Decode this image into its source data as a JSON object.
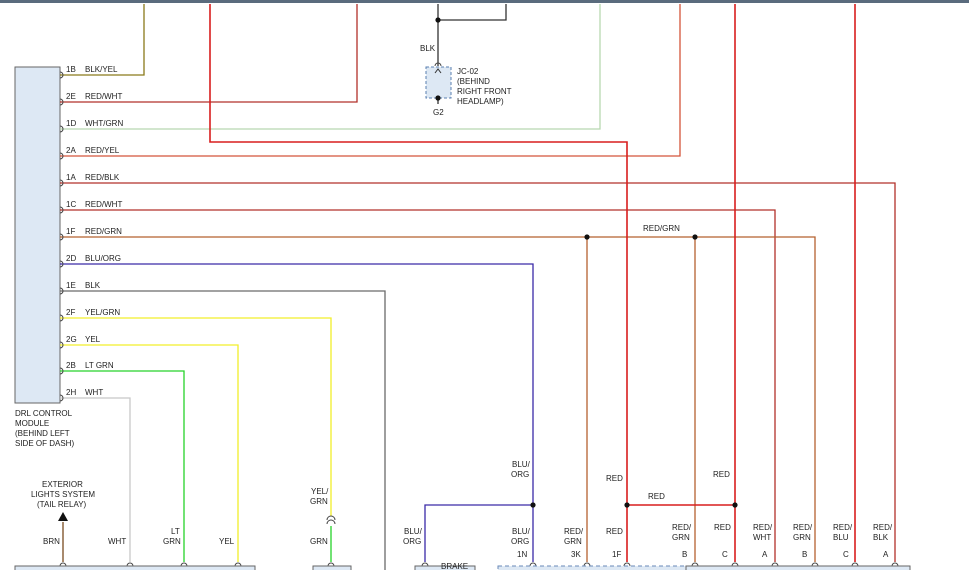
{
  "module": {
    "label_lines": [
      "DRL CONTROL",
      "MODULE",
      "(BEHIND LEFT",
      "SIDE OF DASH)"
    ],
    "pins": [
      {
        "pin": "1B",
        "wire": "BLK/YEL"
      },
      {
        "pin": "2E",
        "wire": "RED/WHT"
      },
      {
        "pin": "1D",
        "wire": "WHT/GRN"
      },
      {
        "pin": "2A",
        "wire": "RED/YEL"
      },
      {
        "pin": "1A",
        "wire": "RED/BLK"
      },
      {
        "pin": "1C",
        "wire": "RED/WHT"
      },
      {
        "pin": "1F",
        "wire": "RED/GRN"
      },
      {
        "pin": "2D",
        "wire": "BLU/ORG"
      },
      {
        "pin": "1E",
        "wire": "BLK"
      },
      {
        "pin": "2F",
        "wire": "YEL/GRN"
      },
      {
        "pin": "2G",
        "wire": "YEL"
      },
      {
        "pin": "2B",
        "wire": "LT GRN"
      },
      {
        "pin": "2H",
        "wire": "WHT"
      }
    ]
  },
  "ground": {
    "wire": "BLK",
    "connector_lines": [
      "JC-02",
      "(BEHIND",
      "RIGHT FRONT",
      "HEADLAMP)"
    ],
    "ground_id": "G2"
  },
  "exterior": {
    "label_lines": [
      "EXTERIOR",
      "LIGHTS SYSTEM",
      "(TAIL RELAY)"
    ]
  },
  "splice_label": "RED/GRN",
  "mid_labels": {
    "blu_org": [
      "BLU/",
      "ORG"
    ],
    "red_top": "RED",
    "red_mid": "RED",
    "red_right": "RED",
    "yel_grn": [
      "YEL/",
      "GRN"
    ]
  },
  "bottom_labels": [
    {
      "lines": [
        "BRN"
      ],
      "pin": ""
    },
    {
      "lines": [
        "WHT"
      ],
      "pin": ""
    },
    {
      "lines": [
        "LT",
        "GRN"
      ],
      "pin": ""
    },
    {
      "lines": [
        "YEL"
      ],
      "pin": ""
    },
    {
      "lines": [
        "GRN"
      ],
      "pin": ""
    },
    {
      "lines": [
        "BLU/",
        "ORG"
      ],
      "pin": ""
    },
    {
      "lines": [
        "BLU/",
        "ORG"
      ],
      "pin": "1N"
    },
    {
      "lines": [
        "RED/",
        "GRN"
      ],
      "pin": "3K"
    },
    {
      "lines": [
        "RED"
      ],
      "pin": "1F"
    },
    {
      "lines": [
        "RED/",
        "GRN"
      ],
      "pin": "B"
    },
    {
      "lines": [
        "RED"
      ],
      "pin": "C"
    },
    {
      "lines": [
        "RED/",
        "WHT"
      ],
      "pin": "A"
    },
    {
      "lines": [
        "RED/",
        "GRN"
      ],
      "pin": "B"
    },
    {
      "lines": [
        "RED/",
        "BLU"
      ],
      "pin": "C"
    },
    {
      "lines": [
        "RED/",
        "BLK"
      ],
      "pin": "A"
    }
  ],
  "brake_label": "BRAKE",
  "colors": {
    "red": "#d81e1e",
    "dark_red": "#b2302a",
    "orange_red": "#d4553a",
    "brown_red": "#b5602f",
    "olive": "#8a7a1a",
    "light_green": "#b8d8b0",
    "blue": "#3a2aa8",
    "gray": "#6a6a6a",
    "yellow": "#f2ef2a",
    "green": "#26d22a",
    "white_wire": "#c8c8c8",
    "brown": "#7a4a20",
    "module_fill": "#dde8f4"
  }
}
